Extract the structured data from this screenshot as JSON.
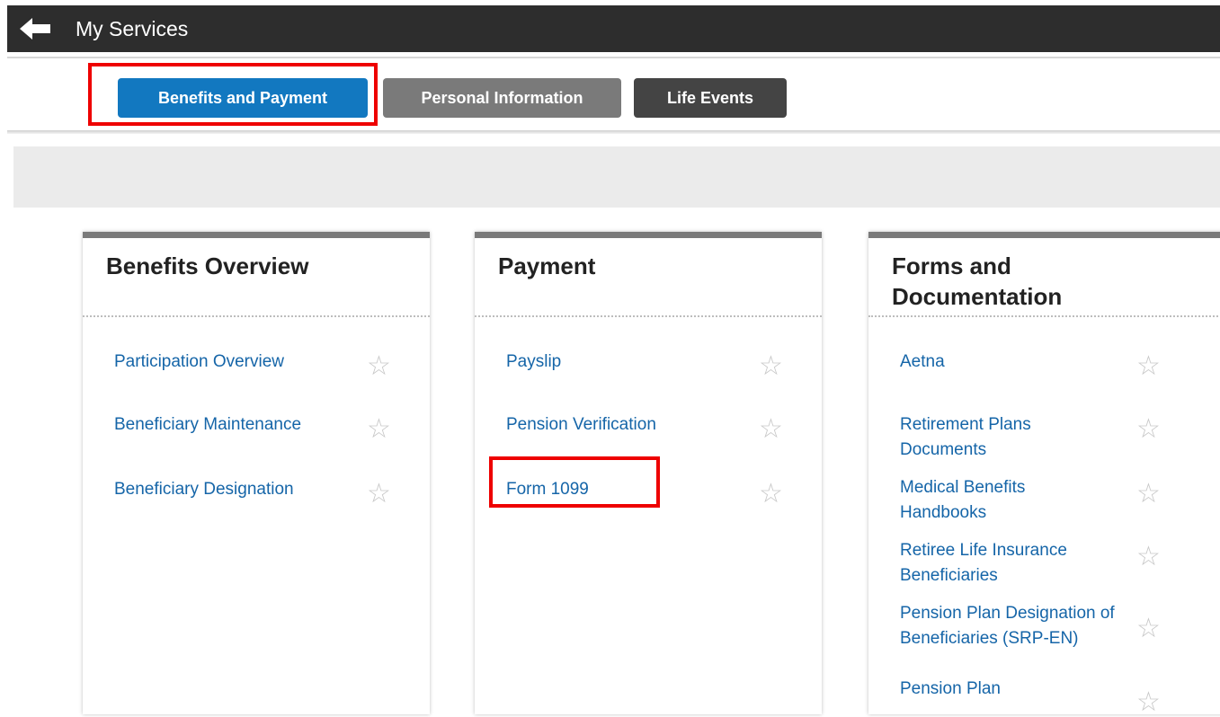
{
  "header": {
    "title": "My Services",
    "back_icon": "arrow-left-icon"
  },
  "tabs": [
    {
      "label": "Benefits and Payment",
      "color": "#1278c0",
      "active": true
    },
    {
      "label": "Personal Information",
      "color": "#7a7a7a"
    },
    {
      "label": "Life Events",
      "color": "#444444"
    }
  ],
  "cards": [
    {
      "title": "Benefits Overview",
      "items": [
        {
          "label": "Participation Overview"
        },
        {
          "label": "Beneficiary Maintenance"
        },
        {
          "label": "Beneficiary Designation"
        }
      ]
    },
    {
      "title": "Payment",
      "items": [
        {
          "label": "Payslip"
        },
        {
          "label": "Pension Verification"
        },
        {
          "label": "Form 1099"
        }
      ]
    },
    {
      "title": "Forms and Documentation",
      "items": [
        {
          "label": "Aetna"
        },
        {
          "label": "Retirement Plans Documents"
        },
        {
          "label": "Medical Benefits Handbooks"
        },
        {
          "label": "Retiree Life Insurance Beneficiaries"
        },
        {
          "label": "Pension Plan Designation of Beneficiaries (SRP-EN)"
        },
        {
          "label": "Pension Plan"
        }
      ]
    }
  ],
  "colors": {
    "link": "#1565a8",
    "highlight": "#ee0000",
    "header_bg": "#2d2d2d"
  }
}
